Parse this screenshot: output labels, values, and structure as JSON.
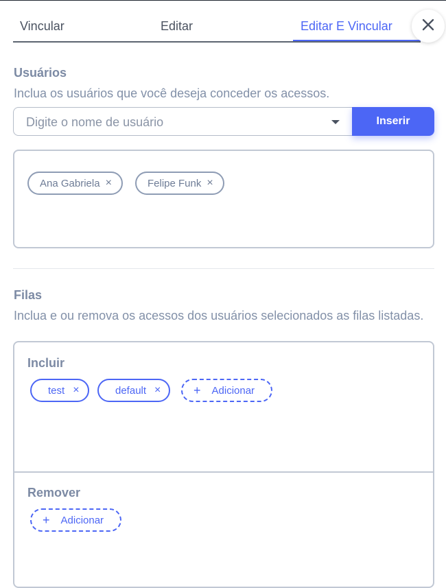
{
  "tabs": [
    {
      "label": "Vincular"
    },
    {
      "label": "Editar"
    },
    {
      "label": "Editar E Vincular",
      "active": true
    }
  ],
  "close_icon": "close-icon",
  "users_section": {
    "title": "Usuários",
    "description": "Inclua os usuários que você deseja conceder os acessos.",
    "search_placeholder": "Digite o nome de usuário",
    "insert_label": "Inserir",
    "selected_users": [
      "Ana Gabriela",
      "Felipe Funk"
    ]
  },
  "queues_section": {
    "title": "Filas",
    "description": "Inclua e ou remova os acessos dos usuários selecionados as filas listadas.",
    "include": {
      "title": "Incluir",
      "queues": [
        "test",
        "default"
      ],
      "add_label": "Adicionar"
    },
    "remove": {
      "title": "Remover",
      "queues": [],
      "add_label": "Adicionar"
    }
  },
  "colors": {
    "accent": "#4c66f5",
    "muted_text": "#8290a8",
    "border": "#c1c8d4"
  }
}
